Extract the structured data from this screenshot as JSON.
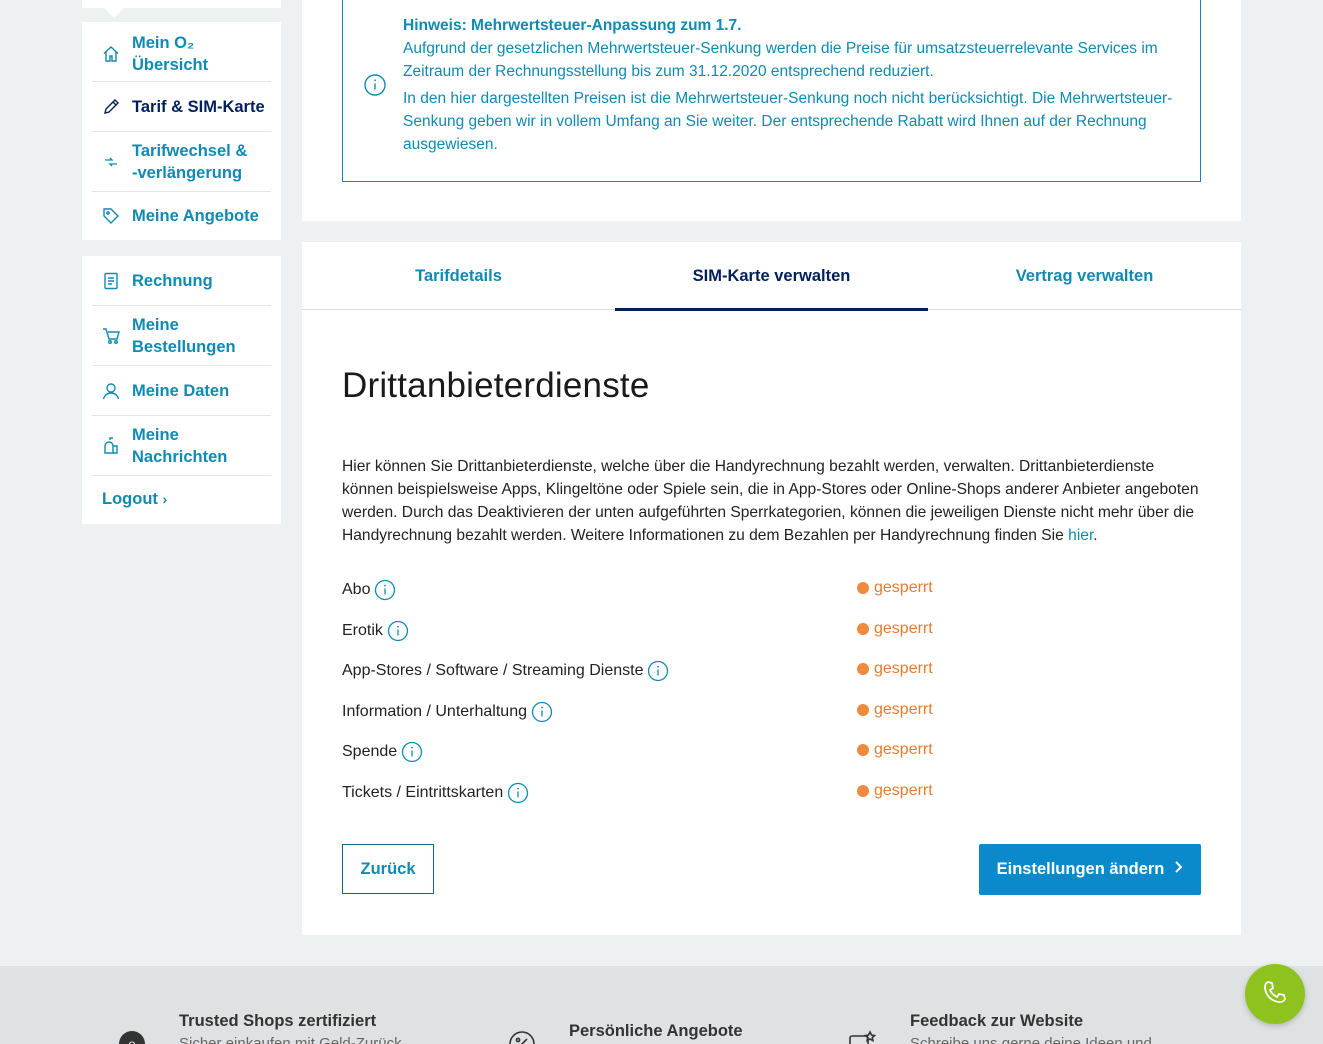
{
  "sidebar": {
    "group1": [
      {
        "label_line1": "Mein O₂",
        "label_line2": "Übersicht",
        "icon": "home-icon"
      },
      {
        "label_line1": "Tarif & SIM-Karte",
        "label_line2": "",
        "icon": "pencil-icon"
      },
      {
        "label_line1": "Tarifwechsel &",
        "label_line2": "-verlängerung",
        "icon": "switch-arrows-icon"
      },
      {
        "label_line1": "Meine Angebote",
        "label_line2": "",
        "icon": "tag-icon"
      }
    ],
    "group2": [
      {
        "label_line1": "Rechnung",
        "label_line2": "",
        "icon": "bill-icon"
      },
      {
        "label_line1": "Meine",
        "label_line2": "Bestellungen",
        "icon": "cart-icon"
      },
      {
        "label_line1": "Meine Daten",
        "label_line2": "",
        "icon": "user-icon"
      },
      {
        "label_line1": "Meine",
        "label_line2": "Nachrichten",
        "icon": "mailbox-icon"
      }
    ],
    "logout": "Logout"
  },
  "notice": {
    "title": "Hinweis: Mehrwertsteuer-Anpassung zum 1.7.",
    "p1": "Aufgrund der gesetzlichen Mehrwertsteuer-Senkung werden die Preise für umsatzsteuerrelevante Services im Zeitraum der Rechnungsstellung bis zum 31.12.2020 entsprechend reduziert.",
    "p2": "In den hier dargestellten Preisen ist die Mehrwertsteuer-Senkung noch nicht berücksichtigt. Die Mehrwertsteuer-Senkung geben wir in vollem Umfang an Sie weiter. Der entsprechende Rabatt wird Ihnen auf der Rechnung ausgewiesen."
  },
  "tabs": [
    "Tarifdetails",
    "SIM-Karte verwalten",
    "Vertrag verwalten"
  ],
  "active_tab": "SIM-Karte verwalten",
  "page": {
    "heading": "Drittanbieterdienste",
    "intro": "Hier können Sie Drittanbieterdienste, welche über die Handyrechnung bezahlt werden, verwalten. Drittanbieterdienste können beispielsweise Apps, Klingeltöne oder Spiele sein, die in App-Stores oder Online-Shops anderer Anbieter angeboten werden. Durch das Deaktivieren der unten aufgeführten Sperrkategorien, können die jeweiligen Dienste nicht mehr über die Handyrechnung bezahlt werden. Weitere Informationen zu dem Bezahlen per Handyrechnung finden Sie ",
    "intro_link": "hier",
    "intro_end": "."
  },
  "categories": [
    {
      "label": "Abo",
      "status": "gesperrt"
    },
    {
      "label": "Erotik",
      "status": "gesperrt"
    },
    {
      "label": "App-Stores / Software / Streaming Dienste",
      "status": "gesperrt"
    },
    {
      "label": "Information / Unterhaltung",
      "status": "gesperrt"
    },
    {
      "label": "Spende",
      "status": "gesperrt"
    },
    {
      "label": "Tickets / Eintrittskarten",
      "status": "gesperrt"
    }
  ],
  "buttons": {
    "back": "Zurück",
    "primary": "Einstellungen ändern"
  },
  "footer": [
    {
      "title": "Trusted Shops zertifiziert",
      "sub": "Sicher einkaufen mit Geld-Zurück",
      "icon": "trusted-shops-icon"
    },
    {
      "title": "Persönliche Angebote",
      "sub": "",
      "icon": "percent-icon"
    },
    {
      "title": "Feedback zur Website",
      "sub": "Schreibe uns gerne deine Ideen und",
      "icon": "feedback-icon"
    }
  ],
  "colors": {
    "accent": "#0f8ab3",
    "navy": "#001f5b",
    "status_locked": "#f08a3e",
    "primary_button": "#0a8acb",
    "fab": "#8dc21f"
  }
}
